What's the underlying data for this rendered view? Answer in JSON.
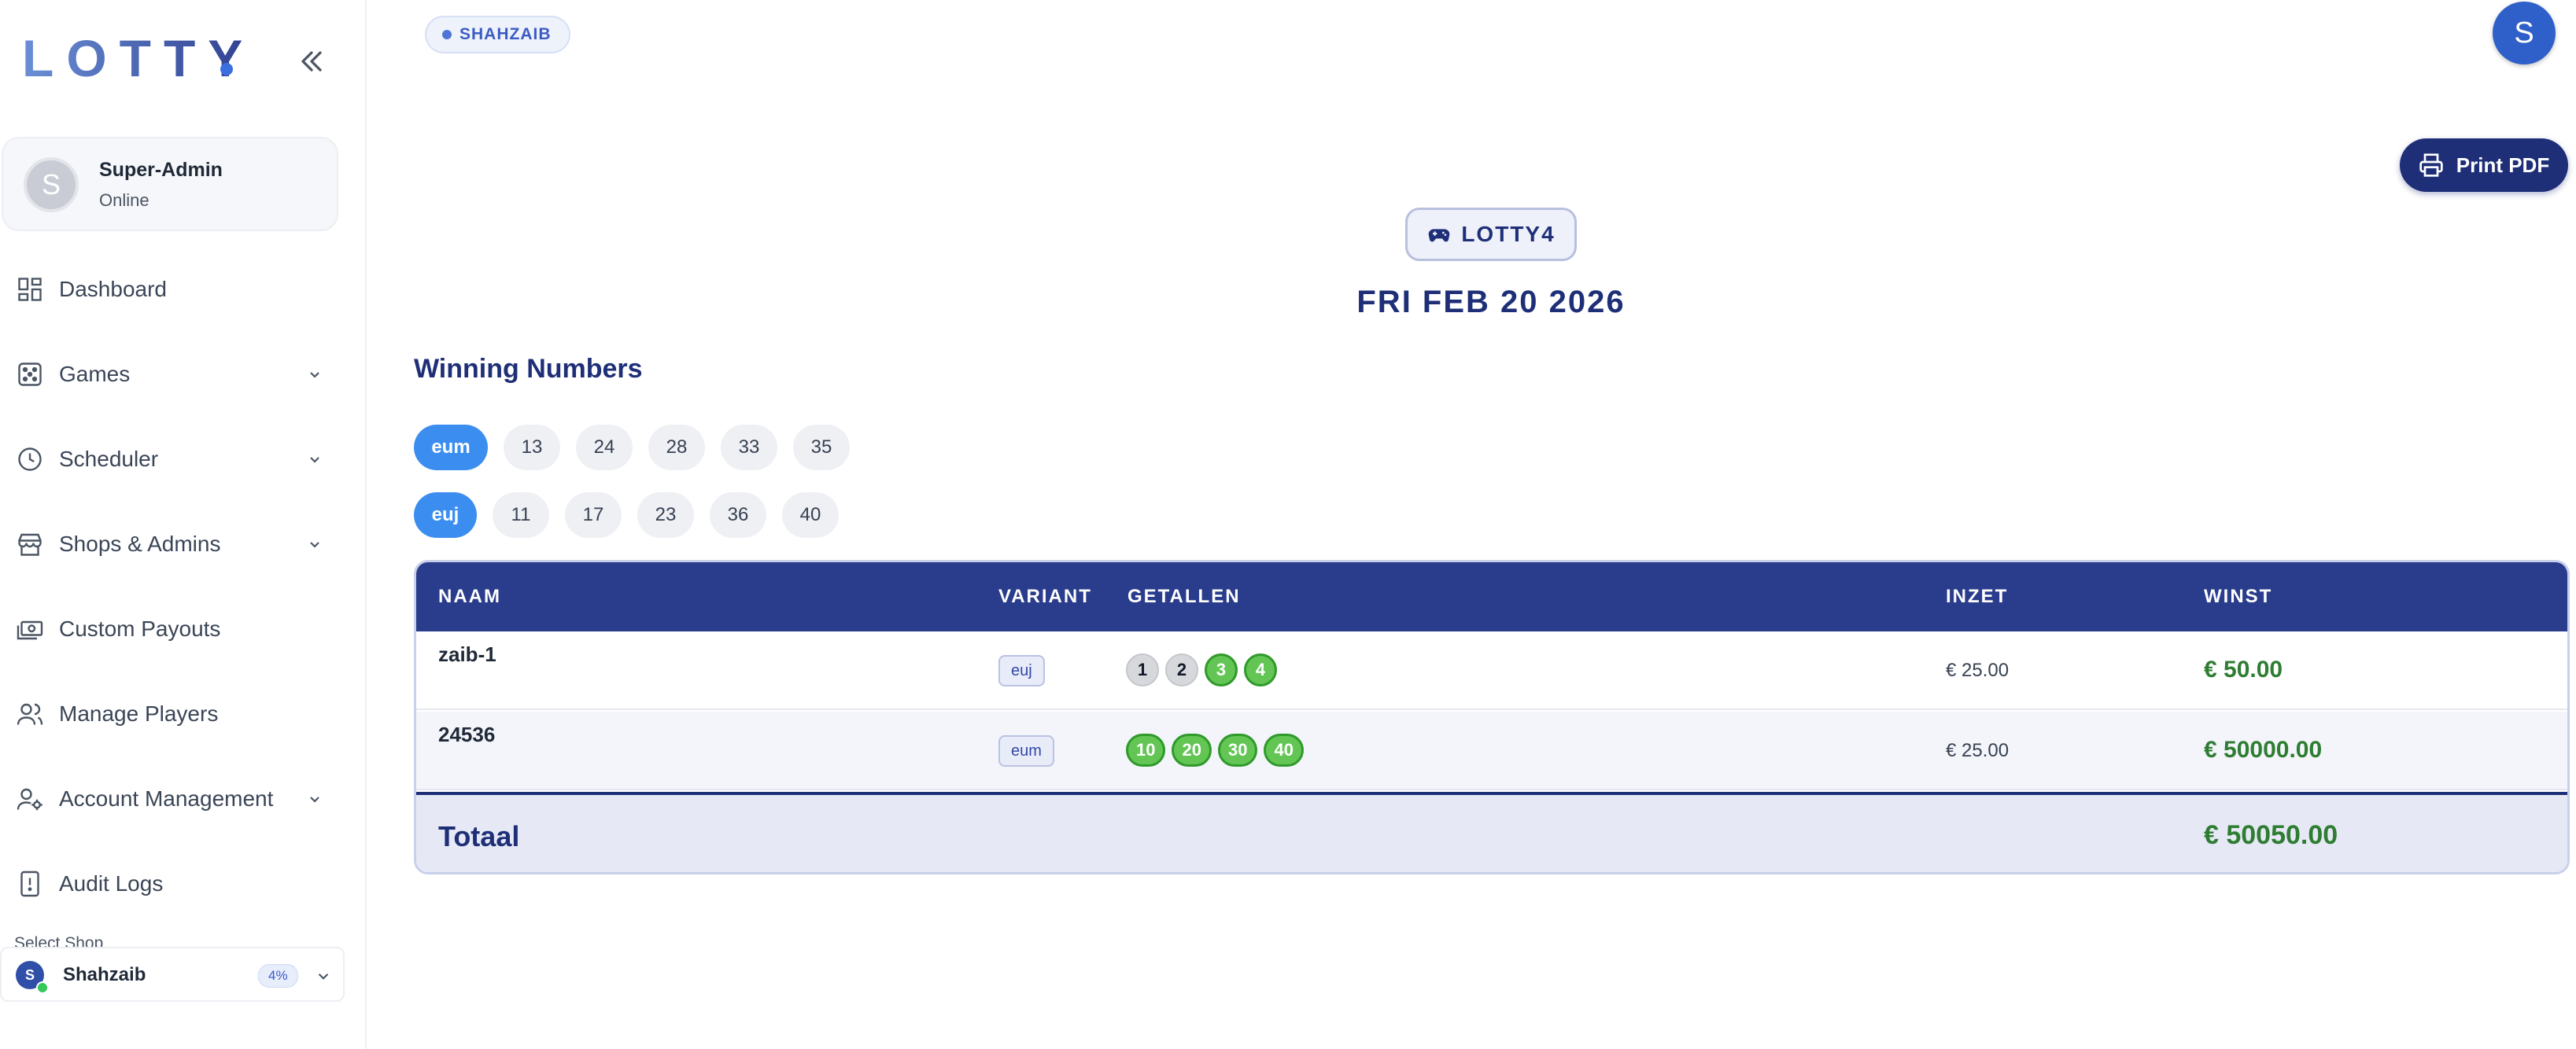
{
  "app": {
    "logo": "LOTTY"
  },
  "user": {
    "initial": "S",
    "name": "Super-Admin",
    "status": "Online"
  },
  "sidebar": {
    "items": [
      {
        "label": "Dashboard",
        "icon": "dashboard-icon"
      },
      {
        "label": "Games",
        "icon": "dice-icon"
      },
      {
        "label": "Scheduler",
        "icon": "clock-icon"
      },
      {
        "label": "Shops & Admins",
        "icon": "store-icon"
      },
      {
        "label": "Custom Payouts",
        "icon": "cash-icon"
      },
      {
        "label": "Manage Players",
        "icon": "users-icon"
      },
      {
        "label": "Account Management",
        "icon": "user-gear-icon"
      },
      {
        "label": "Audit Logs",
        "icon": "log-icon"
      }
    ],
    "select_shop_label": "Select Shop",
    "shop": {
      "initial": "S",
      "name": "Shahzaib",
      "percent": "4%"
    }
  },
  "header": {
    "shop_tag": "SHAHZAIB",
    "avatar_initial": "S",
    "print_label": "Print PDF"
  },
  "game": {
    "name": "LOTTY4",
    "date": "FRI FEB 20 2026"
  },
  "winning": {
    "title": "Winning Numbers",
    "rows": [
      {
        "variant": "eum",
        "numbers": [
          "13",
          "24",
          "28",
          "33",
          "35"
        ]
      },
      {
        "variant": "euj",
        "numbers": [
          "11",
          "17",
          "23",
          "36",
          "40"
        ]
      }
    ]
  },
  "table": {
    "columns": [
      "NAAM",
      "VARIANT",
      "GETALLEN",
      "INZET",
      "WINST"
    ],
    "rows": [
      {
        "name": "zaib-1",
        "variant": "euj",
        "numbers": [
          {
            "value": "1",
            "hit": false
          },
          {
            "value": "2",
            "hit": false
          },
          {
            "value": "3",
            "hit": true
          },
          {
            "value": "4",
            "hit": true
          }
        ],
        "stake": "€ 25.00",
        "win": "€ 50.00"
      },
      {
        "name": "24536",
        "variant": "eum",
        "numbers": [
          {
            "value": "10",
            "hit": true
          },
          {
            "value": "20",
            "hit": true
          },
          {
            "value": "30",
            "hit": true
          },
          {
            "value": "40",
            "hit": true
          }
        ],
        "stake": "€ 25.00",
        "win": "€ 50000.00"
      }
    ],
    "total_label": "Totaal",
    "total_value": "€ 50050.00"
  },
  "colors": {
    "primary": "#1e2f78",
    "header_bg": "#2a3c8c",
    "variant_pill": "#3b8ef0",
    "hit_ball": "#62c554",
    "win_text": "#2e7d32"
  }
}
